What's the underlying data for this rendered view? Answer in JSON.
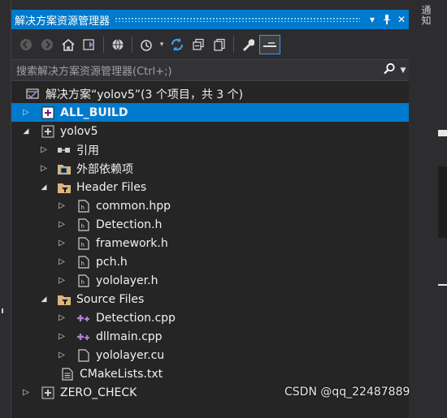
{
  "panel": {
    "title": "解决方案资源管理器",
    "pin_icon": "pin-icon",
    "close_icon": "close-icon"
  },
  "right_panel": {
    "tab_label": "通知"
  },
  "toolbar": {
    "items": [
      "back-icon",
      "forward-icon",
      "home-icon",
      "vs-switch-icon",
      "globe-icon",
      "history-icon",
      "refresh-icon",
      "collapse-all-icon",
      "show-all-files-icon",
      "properties-wrench-icon",
      "preview-icon"
    ]
  },
  "search": {
    "placeholder": "搜索解决方案资源管理器(Ctrl+;)"
  },
  "tree": {
    "solution": "解决方案“yolov5”(3 个项目，共 3 个)",
    "all_build": "ALL_BUILD",
    "yolov5": "yolov5",
    "references": "引用",
    "external_deps": "外部依赖项",
    "header_files": "Header Files",
    "headers": [
      "common.hpp",
      "Detection.h",
      "framework.h",
      "pch.h",
      "yololayer.h"
    ],
    "source_files": "Source Files",
    "sources": [
      "Detection.cpp",
      "dllmain.cpp",
      "yololayer.cu"
    ],
    "cmakelists": "CMakeLists.txt",
    "zero_check": "ZERO_CHECK"
  },
  "watermark": "CSDN @qq_22487889",
  "colors": {
    "accent": "#007acc",
    "panel_bg": "#252526",
    "chrome_bg": "#2d2d30"
  }
}
